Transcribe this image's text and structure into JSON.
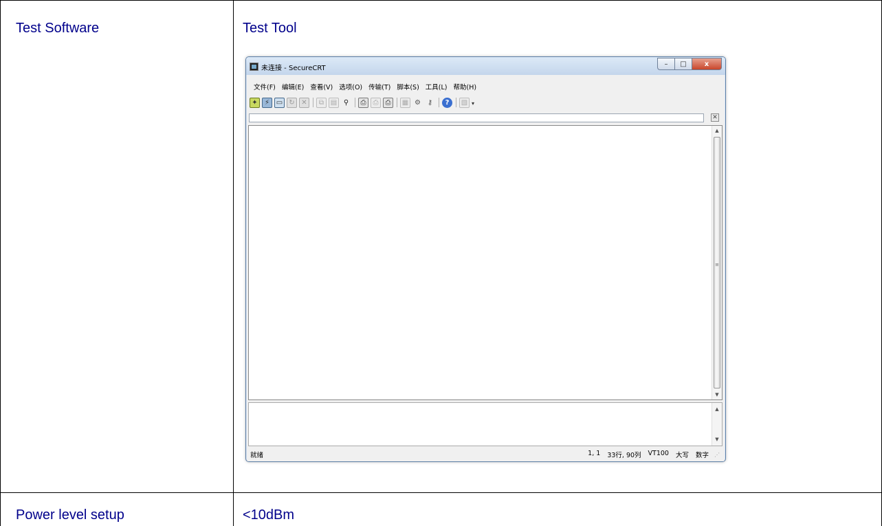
{
  "table": {
    "row1": {
      "label": "Test Software",
      "value": "Test Tool"
    },
    "row2": {
      "label": "Power level setup",
      "value": "<10dBm"
    }
  },
  "securecrt": {
    "title": "未连接 - SecureCRT",
    "caption": {
      "minimize": "–",
      "maximize": "□",
      "close": "x"
    },
    "menus": [
      "文件(F)",
      "编辑(E)",
      "查看(V)",
      "选项(O)",
      "传输(T)",
      "脚本(S)",
      "工具(L)",
      "帮助(H)"
    ],
    "toolbar_icons": [
      "connect-icon",
      "quick-connect-icon",
      "connect-tab-icon",
      "reconnect-icon",
      "disconnect-icon",
      "copy-icon",
      "paste-icon",
      "find-icon",
      "print-icon",
      "print-selection-icon",
      "printer-setup-icon",
      "session-options-icon",
      "global-options-icon",
      "key-icon",
      "help-icon",
      "keymap-icon"
    ],
    "status": {
      "ready": "就绪",
      "position": "1,  1",
      "size": "33行, 90列",
      "emulation": "VT100",
      "caps": "大写",
      "num": "数字"
    }
  },
  "colors": {
    "text": "#00008b",
    "border": "#000000",
    "window_frame": "#5c7ea6"
  }
}
